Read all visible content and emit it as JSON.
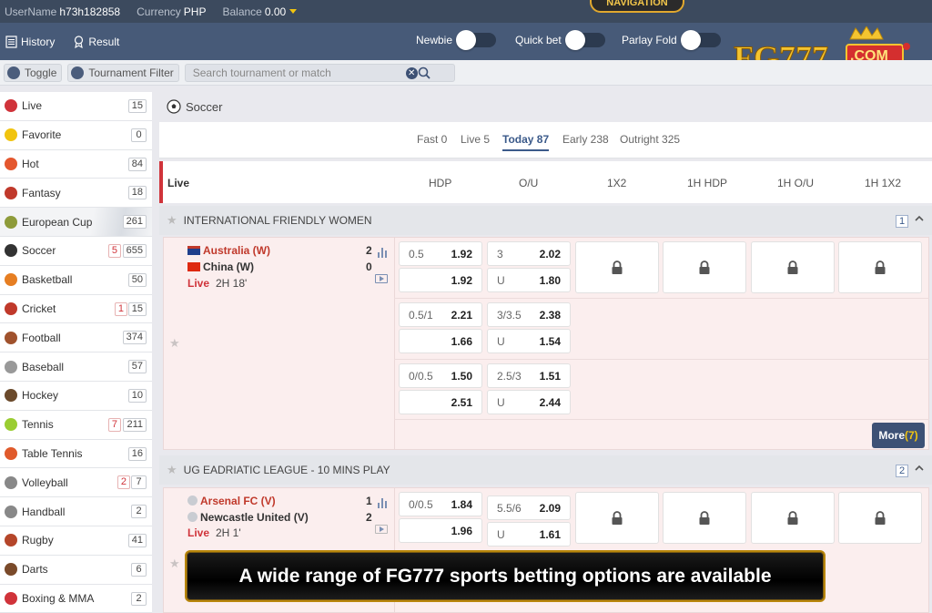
{
  "topbar": {
    "username_label": "UserName",
    "username": "h73h182858",
    "currency_label": "Currency",
    "currency": "PHP",
    "balance_label": "Balance",
    "balance": "0.00",
    "navigation_badge": "NAVIGATION"
  },
  "nav": {
    "history": "History",
    "result": "Result",
    "toggles": [
      {
        "label": "Newbie"
      },
      {
        "label": "Quick bet"
      },
      {
        "label": "Parlay Fold"
      }
    ],
    "logo_text": "FG777",
    "logo_sub": ".COM"
  },
  "filter": {
    "toggle": "Toggle",
    "tournament_filter": "Tournament Filter",
    "search_placeholder": "Search tournament or match"
  },
  "sports": [
    {
      "name": "Live",
      "count": "15",
      "live": "",
      "icon": "live-icon",
      "color": "#d0333a"
    },
    {
      "name": "Favorite",
      "count": "0",
      "live": "",
      "icon": "star-icon",
      "color": "#f1c40f"
    },
    {
      "name": "Hot",
      "count": "84",
      "live": "",
      "icon": "fire-icon",
      "color": "#e4572e"
    },
    {
      "name": "Fantasy",
      "count": "18",
      "live": "",
      "icon": "fantasy-icon",
      "color": "#c0392b"
    },
    {
      "name": "European Cup",
      "count": "261",
      "live": "",
      "icon": "trophy-icon",
      "color": "#8e9b3a"
    },
    {
      "name": "Soccer",
      "count": "655",
      "live": "5",
      "icon": "soccer-ball-icon",
      "color": "#333333"
    },
    {
      "name": "Basketball",
      "count": "50",
      "live": "",
      "icon": "basketball-icon",
      "color": "#e67e22"
    },
    {
      "name": "Cricket",
      "count": "15",
      "live": "1",
      "icon": "cricket-icon",
      "color": "#c0392b"
    },
    {
      "name": "Football",
      "count": "374",
      "live": "",
      "icon": "football-icon",
      "color": "#a0522d"
    },
    {
      "name": "Baseball",
      "count": "57",
      "live": "",
      "icon": "baseball-icon",
      "color": "#999999"
    },
    {
      "name": "Hockey",
      "count": "10",
      "live": "",
      "icon": "hockey-icon",
      "color": "#6b4a2b"
    },
    {
      "name": "Tennis",
      "count": "211",
      "live": "7",
      "icon": "tennis-icon",
      "color": "#9acd32"
    },
    {
      "name": "Table Tennis",
      "count": "16",
      "live": "",
      "icon": "table-tennis-icon",
      "color": "#e05a2b"
    },
    {
      "name": "Volleyball",
      "count": "7",
      "live": "2",
      "icon": "volleyball-icon",
      "color": "#888888"
    },
    {
      "name": "Handball",
      "count": "2",
      "live": "",
      "icon": "handball-icon",
      "color": "#888888"
    },
    {
      "name": "Rugby",
      "count": "41",
      "live": "",
      "icon": "rugby-icon",
      "color": "#b5462a"
    },
    {
      "name": "Darts",
      "count": "6",
      "live": "",
      "icon": "darts-icon",
      "color": "#7a4a2a"
    },
    {
      "name": "Boxing & MMA",
      "count": "2",
      "live": "",
      "icon": "boxing-icon",
      "color": "#d0333a"
    }
  ],
  "main": {
    "sport_title": "Soccer",
    "tabs": [
      {
        "label": "Fast 0",
        "active": false
      },
      {
        "label": "Live 5",
        "active": false
      },
      {
        "label": "Today 87",
        "active": true
      },
      {
        "label": "Early 238",
        "active": false
      },
      {
        "label": "Outright 325",
        "active": false
      }
    ],
    "columns": [
      "Live",
      "HDP",
      "O/U",
      "1X2",
      "1H HDP",
      "1H O/U",
      "1H 1X2"
    ],
    "leagues": [
      {
        "name": "INTERNATIONAL FRIENDLY WOMEN",
        "count": "1",
        "home": "Australia (W)",
        "away": "China (W)",
        "home_score": "2",
        "away_score": "0",
        "live_label": "Live",
        "time": "2H 18'",
        "rows": [
          {
            "hdp": "0.5",
            "hdp_home": "1.92",
            "hdp_away": "1.92",
            "ou": "3",
            "ou_over": "2.02",
            "ou_under_label": "U",
            "ou_under": "1.80"
          },
          {
            "hdp": "0.5/1",
            "hdp_home": "2.21",
            "hdp_away": "1.66",
            "ou": "3/3.5",
            "ou_over": "2.38",
            "ou_under_label": "U",
            "ou_under": "1.54"
          },
          {
            "hdp": "0/0.5",
            "hdp_home": "1.50",
            "hdp_away": "2.51",
            "ou": "2.5/3",
            "ou_over": "1.51",
            "ou_under_label": "U",
            "ou_under": "2.44"
          }
        ],
        "more_label": "More",
        "more_count": "(7)"
      },
      {
        "name": "UG EADRIATIC LEAGUE - 10 MINS PLAY",
        "count": "2",
        "home": "Arsenal FC (V)",
        "away": "Newcastle United (V)",
        "home_score": "1",
        "away_score": "2",
        "live_label": "Live",
        "time": "2H 1'",
        "rows": [
          {
            "hdp": "0/0.5",
            "hdp_home": "1.84",
            "hdp_away": "1.96",
            "ou": "5.5/6",
            "ou_over": "2.09",
            "ou_under_label": "U",
            "ou_under": "1.61"
          }
        ]
      }
    ]
  },
  "caption": "A wide range of FG777 sports betting options are available"
}
